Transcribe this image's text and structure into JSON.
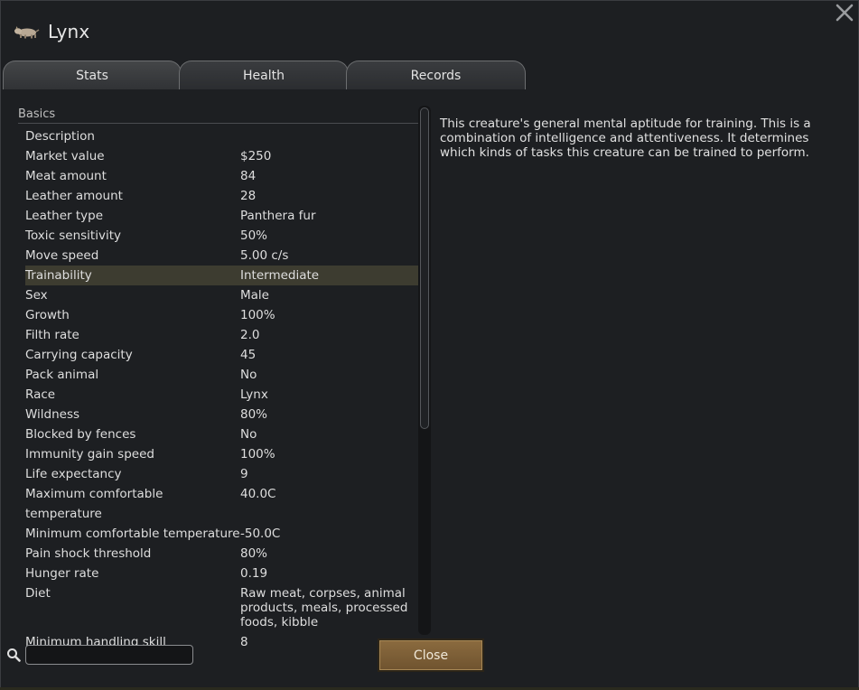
{
  "window": {
    "title": "Lynx",
    "title_icon": "lynx-animal-icon",
    "close_icon": "close-x-icon"
  },
  "tabs": [
    {
      "label": "Stats",
      "active": true
    },
    {
      "label": "Health",
      "active": false
    },
    {
      "label": "Records",
      "active": false
    }
  ],
  "section": {
    "header": "Basics"
  },
  "stats": [
    {
      "label": "Description",
      "value": ""
    },
    {
      "label": "Market value",
      "value": "$250"
    },
    {
      "label": "Meat amount",
      "value": "84"
    },
    {
      "label": "Leather amount",
      "value": "28"
    },
    {
      "label": "Leather type",
      "value": "Panthera fur"
    },
    {
      "label": "Toxic sensitivity",
      "value": "50%"
    },
    {
      "label": "Move speed",
      "value": "5.00 c/s"
    },
    {
      "label": "Trainability",
      "value": "Intermediate",
      "highlighted": true
    },
    {
      "label": "Sex",
      "value": "Male"
    },
    {
      "label": "Growth",
      "value": "100%"
    },
    {
      "label": "Filth rate",
      "value": "2.0"
    },
    {
      "label": "Carrying capacity",
      "value": "45"
    },
    {
      "label": "Pack animal",
      "value": "No"
    },
    {
      "label": "Race",
      "value": "Lynx"
    },
    {
      "label": "Wildness",
      "value": "80%"
    },
    {
      "label": "Blocked by fences",
      "value": "No"
    },
    {
      "label": "Immunity gain speed",
      "value": "100%"
    },
    {
      "label": "Life expectancy",
      "value": "9"
    },
    {
      "label": "Maximum comfortable temperature",
      "value": "40.0C"
    },
    {
      "label": "Minimum comfortable temperature",
      "value": "-50.0C"
    },
    {
      "label": "Pain shock threshold",
      "value": "80%"
    },
    {
      "label": "Hunger rate",
      "value": "0.19"
    },
    {
      "label": "Diet",
      "value": "Raw meat, corpses, animal products, meals, processed foods, kibble"
    },
    {
      "label": "Minimum handling skill",
      "value": "8"
    }
  ],
  "description": "This creature's general mental aptitude for training. This is a combination of intelligence and attentiveness. It determines which kinds of tasks this creature can be trained to perform.",
  "search": {
    "value": "",
    "placeholder": "",
    "icon": "search-icon"
  },
  "footer": {
    "close_label": "Close"
  },
  "colors": {
    "highlight_row": "#3d3c30",
    "close_button": "#7d5f37",
    "background": "#1d1f22"
  }
}
